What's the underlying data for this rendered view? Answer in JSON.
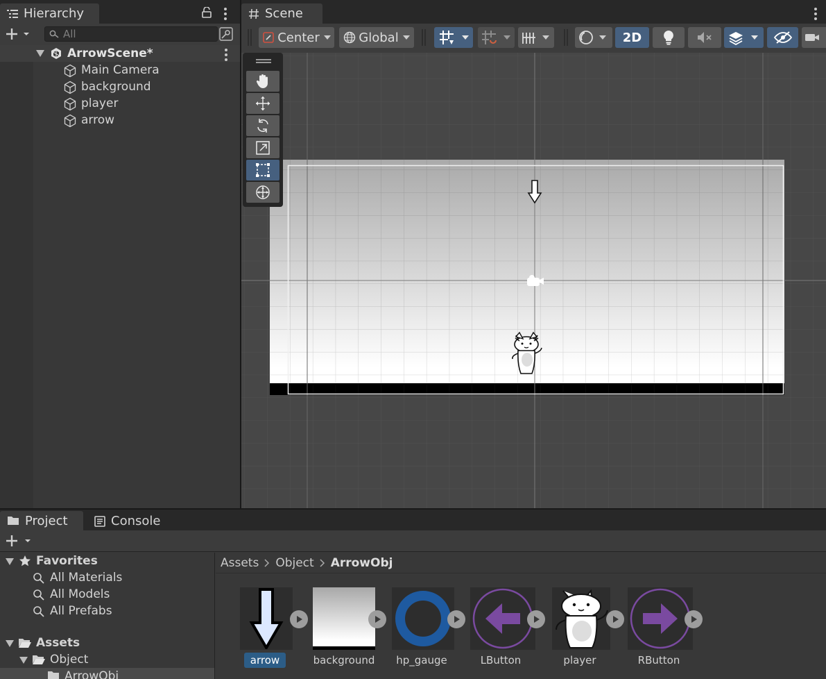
{
  "hierarchy": {
    "tab_label": "Hierarchy",
    "search_placeholder": "All",
    "scene_name": "ArrowScene*",
    "items": [
      {
        "label": "Main Camera"
      },
      {
        "label": "background"
      },
      {
        "label": "player"
      },
      {
        "label": "arrow"
      }
    ]
  },
  "scene": {
    "tab_label": "Scene",
    "pivot_label": "Center",
    "space_label": "Global",
    "mode_2d_label": "2D",
    "active_tool": "rect-tool",
    "tools": [
      "hand-tool",
      "move-tool",
      "rotate-tool",
      "scale-tool",
      "rect-tool",
      "transform-tool"
    ]
  },
  "project": {
    "tab_project": "Project",
    "tab_console": "Console",
    "favorites_label": "Favorites",
    "favorites": [
      {
        "label": "All Materials"
      },
      {
        "label": "All Models"
      },
      {
        "label": "All Prefabs"
      }
    ],
    "assets_label": "Assets",
    "object_folder": "Object",
    "arrowobj_folder": "ArrowObj",
    "breadcrumb": {
      "root": "Assets",
      "mid": "Object",
      "current": "ArrowObj"
    },
    "assets": [
      {
        "label": "arrow"
      },
      {
        "label": "background"
      },
      {
        "label": "hp_gauge"
      },
      {
        "label": "LButton"
      },
      {
        "label": "player"
      },
      {
        "label": "RButton"
      }
    ],
    "selected_asset": "arrow"
  },
  "colors": {
    "selection": "#2c5d87",
    "active_button": "#46607f",
    "button_purple": "#7a4aa0",
    "gauge_blue": "#1e5aa0"
  }
}
